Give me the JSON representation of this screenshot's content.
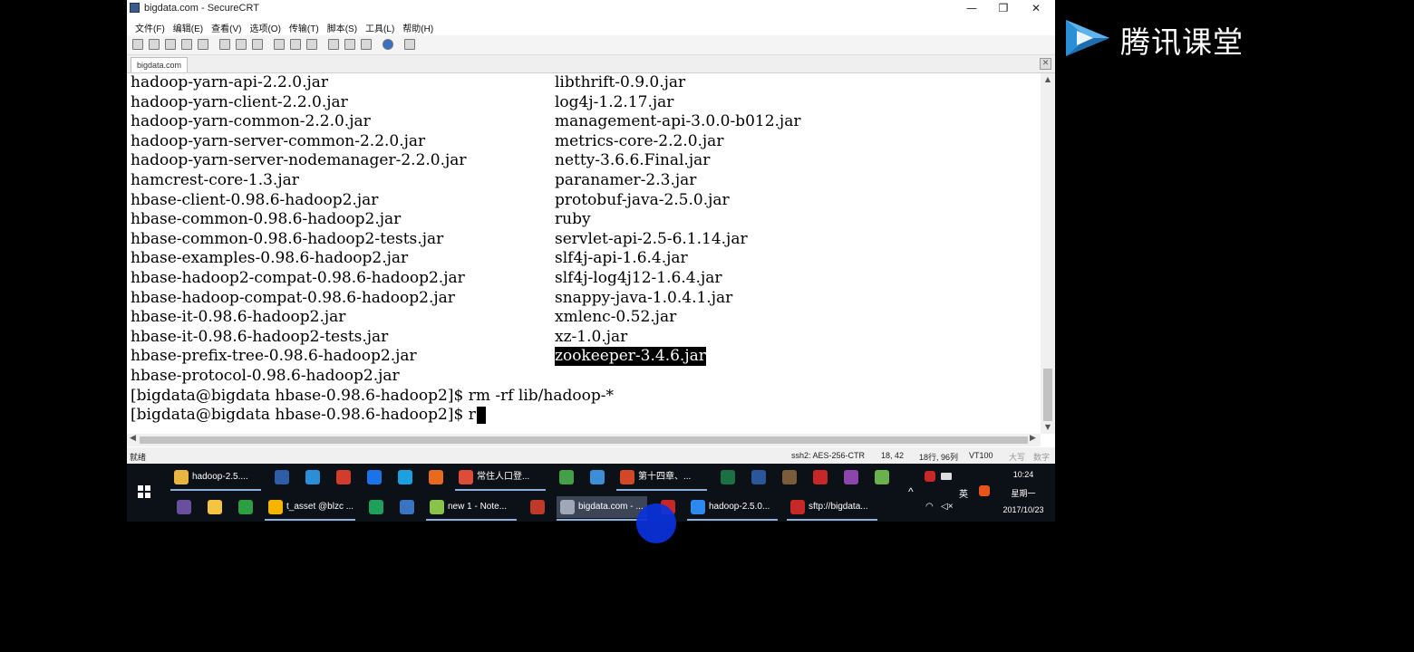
{
  "window": {
    "title": "bigdata.com - SecureCRT",
    "minimize_glyph": "—",
    "maximize_glyph": "❐",
    "close_glyph": "✕"
  },
  "menu": [
    "文件(F)",
    "编辑(E)",
    "查看(V)",
    "选项(O)",
    "传输(T)",
    "脚本(S)",
    "工具(L)",
    "帮助(H)"
  ],
  "tab": {
    "label": "bigdata.com",
    "close_glyph": "✕"
  },
  "terminal": {
    "left_column": [
      "hadoop-yarn-api-2.2.0.jar",
      "hadoop-yarn-client-2.2.0.jar",
      "hadoop-yarn-common-2.2.0.jar",
      "hadoop-yarn-server-common-2.2.0.jar",
      "hadoop-yarn-server-nodemanager-2.2.0.jar",
      "hamcrest-core-1.3.jar",
      "hbase-client-0.98.6-hadoop2.jar",
      "hbase-common-0.98.6-hadoop2.jar",
      "hbase-common-0.98.6-hadoop2-tests.jar",
      "hbase-examples-0.98.6-hadoop2.jar",
      "hbase-hadoop2-compat-0.98.6-hadoop2.jar",
      "hbase-hadoop-compat-0.98.6-hadoop2.jar",
      "hbase-it-0.98.6-hadoop2.jar",
      "hbase-it-0.98.6-hadoop2-tests.jar",
      "hbase-prefix-tree-0.98.6-hadoop2.jar",
      "hbase-protocol-0.98.6-hadoop2.jar"
    ],
    "right_column": [
      "libthrift-0.9.0.jar",
      "log4j-1.2.17.jar",
      "management-api-3.0.0-b012.jar",
      "metrics-core-2.2.0.jar",
      "netty-3.6.6.Final.jar",
      "paranamer-2.3.jar",
      "protobuf-java-2.5.0.jar",
      "ruby",
      "servlet-api-2.5-6.1.14.jar",
      "slf4j-api-1.6.4.jar",
      "slf4j-log4j12-1.6.4.jar",
      "snappy-java-1.0.4.1.jar",
      "xmlenc-0.52.jar",
      "xz-1.0.jar",
      "zookeeper-3.4.6.jar"
    ],
    "command_line_1": "[bigdata@bigdata hbase-0.98.6-hadoop2]$ rm -rf lib/hadoop-*",
    "command_line_2": "[bigdata@bigdata hbase-0.98.6-hadoop2]$ r",
    "highlighted_item": "zookeeper-3.4.6.jar"
  },
  "statusbar": {
    "ready": "就绪",
    "session": "ssh2: AES-256-CTR",
    "cursor_pos": "18, 42",
    "rows_cols": "18行, 96列",
    "emulation": "VT100",
    "caps": "大写",
    "num": "数字"
  },
  "taskbar": {
    "top_row": [
      {
        "label": "hadoop-2.5....",
        "color": "#e8b640"
      },
      {
        "label": "",
        "color": "#2f5ea8"
      },
      {
        "label": "",
        "color": "#2a8fd8"
      },
      {
        "label": "",
        "color": "#d23c2c"
      },
      {
        "label": "",
        "color": "#1a73e8"
      },
      {
        "label": "",
        "color": "#1ba1e2"
      },
      {
        "label": "",
        "color": "#e86a1c"
      },
      {
        "label": "常住人口登...",
        "color": "#dd4b39"
      },
      {
        "label": "",
        "color": "#43a047"
      },
      {
        "label": "",
        "color": "#3b8fd8"
      },
      {
        "label": "第十四章、...",
        "color": "#d24726"
      },
      {
        "label": "",
        "color": "#1d7044"
      },
      {
        "label": "",
        "color": "#2b579a"
      },
      {
        "label": "",
        "color": "#7a5c3a"
      },
      {
        "label": "",
        "color": "#c62828"
      },
      {
        "label": "",
        "color": "#8e44ad"
      },
      {
        "label": "",
        "color": "#6ab04c"
      }
    ],
    "bottom_row": [
      {
        "label": "",
        "color": "#6a4fa0"
      },
      {
        "label": "",
        "color": "#f4c542"
      },
      {
        "label": "",
        "color": "#2e9e44"
      },
      {
        "label": "t_asset @blzc ...",
        "color": "#f4b400"
      },
      {
        "label": "",
        "color": "#1e9f5a"
      },
      {
        "label": "",
        "color": "#3a75c4"
      },
      {
        "label": "new 1 - Note...",
        "color": "#8bc34a"
      },
      {
        "label": "",
        "color": "#c0392b"
      },
      {
        "label": "bigdata.com - ...",
        "color": "#a0a8b8"
      },
      {
        "label": "",
        "color": "#c62828"
      },
      {
        "label": "hadoop-2.5.0...",
        "color": "#2d89ef"
      },
      {
        "label": "sftp://bigdata...",
        "color": "#c62828"
      }
    ],
    "tray_caret": "^",
    "ime": "英",
    "clock_time": "10:24",
    "clock_day": "星期一",
    "clock_date": "2017/10/23"
  },
  "overlay_logo": {
    "text": "腾讯课堂"
  }
}
